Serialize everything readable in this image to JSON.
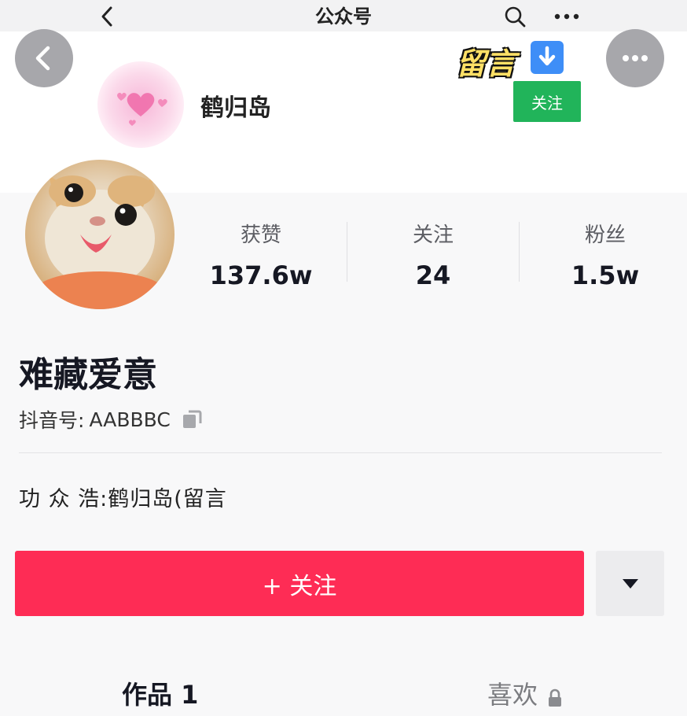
{
  "nav": {
    "title": "公众号",
    "back_icon": "chevron-left-icon",
    "search_icon": "search-icon",
    "more_icon": "more-horizontal-icon"
  },
  "account_card": {
    "name": "鹤归岛",
    "tag": "留言",
    "follow_label": "关注",
    "avatar": "pink-hearts"
  },
  "profile": {
    "stats": [
      {
        "label": "获赞",
        "value": "137.6w"
      },
      {
        "label": "关注",
        "value": "24"
      },
      {
        "label": "粉丝",
        "value": "1.5w"
      }
    ],
    "nickname": "难藏爱意",
    "douyin_id_label": "抖音号:",
    "douyin_id": "AABBBC",
    "bio": "功 众 浩:鹤归岛(留言",
    "follow_button": "+ 关注",
    "tabs": [
      {
        "label": "作品 1"
      },
      {
        "label": "喜欢"
      }
    ]
  },
  "colors": {
    "primary": "#fe2c55",
    "wechat_green": "#21b45a",
    "text": "#161823"
  }
}
